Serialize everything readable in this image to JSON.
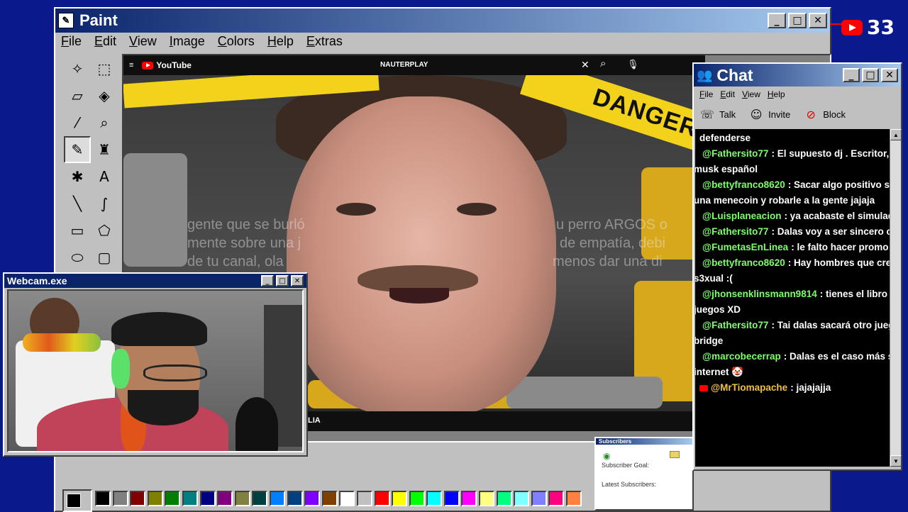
{
  "paint": {
    "title": "Paint",
    "menu": [
      "File",
      "Edit",
      "View",
      "Image",
      "Colors",
      "Help",
      "Extras"
    ],
    "tools": [
      "free-select",
      "rect-select",
      "eraser",
      "fill",
      "color-picker",
      "magnifier",
      "pencil",
      "brush",
      "airbrush",
      "text",
      "line",
      "curve",
      "rectangle",
      "polygon",
      "ellipse",
      "rounded-rect"
    ],
    "palette": [
      "#000000",
      "#808080",
      "#800000",
      "#808000",
      "#008000",
      "#008080",
      "#000080",
      "#800080",
      "#808040",
      "#004040",
      "#0080ff",
      "#004080",
      "#8000ff",
      "#804000",
      "#ffffff",
      "#c0c0c0",
      "#ff0000",
      "#ffff00",
      "#00ff00",
      "#00ffff",
      "#0000ff",
      "#ff00ff",
      "#ffff80",
      "#00ff80",
      "#80ffff",
      "#8080ff",
      "#ff0080",
      "#ff8040"
    ]
  },
  "video": {
    "brand": "YouTube",
    "query": "NAUTERPLAY",
    "tape_text": "DANGER",
    "caption": "LIA",
    "overlay_lines": [
      "gente que se burló",
      "mente sobre una j",
      "de tu canal, ola",
      "u perro ARGOS o",
      "de empatía, debi",
      "menos dar una di"
    ]
  },
  "subscribers": {
    "title": "Subscribers",
    "goal_label": "Subscriber Goal:",
    "latest_label": "Latest Subscribers:"
  },
  "youtube_count": "33",
  "chat": {
    "title": "Chat",
    "menu": [
      "File",
      "Edit",
      "View",
      "Help"
    ],
    "toolbar": [
      {
        "label": "Talk",
        "icon": "talk-icon"
      },
      {
        "label": "Invite",
        "icon": "invite-icon"
      },
      {
        "label": "Block",
        "icon": "block-icon"
      }
    ],
    "lead_line": "defenderse",
    "messages": [
      {
        "user": "@Fathersito77",
        "text": " : El supuesto dj . Escritor, filo",
        "cont": "musk español",
        "gold": false
      },
      {
        "user": "@bettyfranco8620",
        "text": " : Sacar algo positivo si te",
        "cont": "una menecoin y robarle a la gente jajaja",
        "gold": false
      },
      {
        "user": "@Luisplaneacion",
        "text": " : ya acabaste el simulador",
        "cont": "",
        "gold": false
      },
      {
        "user": "@Fathersito77",
        "text": " : Dalas voy a ser sincero cont",
        "cont": "",
        "gold": false
      },
      {
        "user": "@FumetasEnLinea",
        "text": " : le falto hacer promo de",
        "cont": "",
        "gold": false
      },
      {
        "user": "@bettyfranco8620",
        "text": " : Hay hombres que creen",
        "cont": "s3xual :(",
        "gold": false
      },
      {
        "user": "@jhonsenklinsmann9814",
        "text": " : tienes el libro de",
        "cont": "juegos XD",
        "gold": false
      },
      {
        "user": "@Fathersito77",
        "text": " : Tai dalas sacará otro juego",
        "cont": "bridge",
        "gold": false
      },
      {
        "user": "@marcobecerrap",
        "text": " : Dalas es el caso más sev",
        "cont": "internet 🤡",
        "gold": false
      },
      {
        "user": "@MrTiomapache",
        "text": " : jajajajja",
        "cont": "",
        "gold": true
      }
    ]
  },
  "webcam": {
    "title": "Webcam.exe"
  }
}
